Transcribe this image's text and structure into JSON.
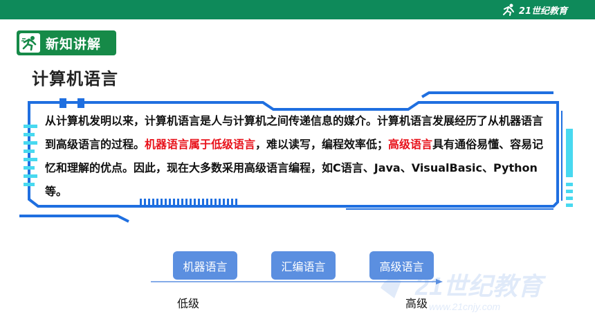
{
  "header": {
    "logo_text": "21世纪教育"
  },
  "section_badge": {
    "label": "新知讲解",
    "icon": "runner-icon"
  },
  "page_title": "计算机语言",
  "content": {
    "seg1": "从计算机发明以来，计算机语言是人与计算机之间传递信息的媒介。计算机语言发展经历了从机器语言到高级语言的过程。",
    "seg2_red": "机器语言属于低级语言",
    "seg3": "，难以读写，编程效率低；",
    "seg4_red": "高级语言",
    "seg5": "具有通俗易懂、容易记忆和理解的优点。因此，现在大多数采用高级语言编程，如C语言、Java、VisualBasic、Python等。"
  },
  "diagram": {
    "stages": [
      "机器语言",
      "汇编语言",
      "高级语言"
    ],
    "low_label": "低级",
    "high_label": "高级"
  },
  "watermark": {
    "text": "21世纪教育",
    "url_text": "www.21cnjy.com"
  },
  "colors": {
    "top_bar": "#0e8a5a",
    "badge": "#168a48",
    "frame_blue": "#1f6fe0",
    "accent_cyan": "#48d9f0",
    "highlight_red": "#e8111a",
    "pill_blue": "#5b8fe0"
  }
}
